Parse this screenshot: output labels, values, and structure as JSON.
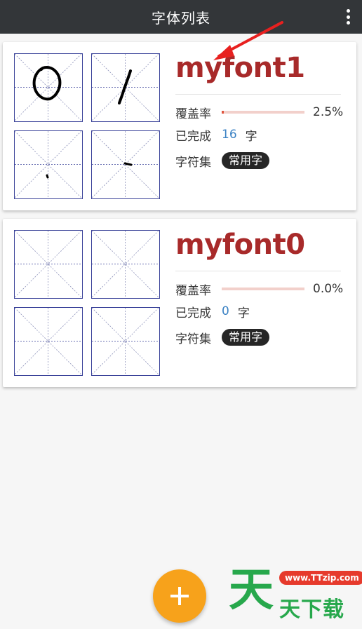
{
  "appbar": {
    "title": "字体列表",
    "more_icon": "overflow-menu-icon"
  },
  "fonts": [
    {
      "name": "myfont1",
      "coverage_label": "覆盖率",
      "coverage_value": "2.5%",
      "coverage_fraction": 0.025,
      "completed_label": "已完成",
      "completed_count": "16",
      "completed_unit": "字",
      "charset_label": "字符集",
      "charset_value": "常用字"
    },
    {
      "name": "myfont0",
      "coverage_label": "覆盖率",
      "coverage_value": "0.0%",
      "coverage_fraction": 0.0,
      "completed_label": "已完成",
      "completed_count": "0",
      "completed_unit": "字",
      "charset_label": "字符集",
      "charset_value": "常用字"
    }
  ],
  "fab": {
    "icon": "plus-icon"
  },
  "watermark": {
    "url": "www.TTzip.com",
    "big": "天",
    "sub": "天下载"
  },
  "colors": {
    "appbar": "#333639",
    "font_name": "#a82a2a",
    "progress_fill": "#e0553f",
    "progress_track": "#f2d0cb",
    "count": "#3b82c4",
    "badge": "#262626",
    "fab": "#f7a21b",
    "grid_border": "#3a4299",
    "annotation_arrow": "#e8201f"
  }
}
